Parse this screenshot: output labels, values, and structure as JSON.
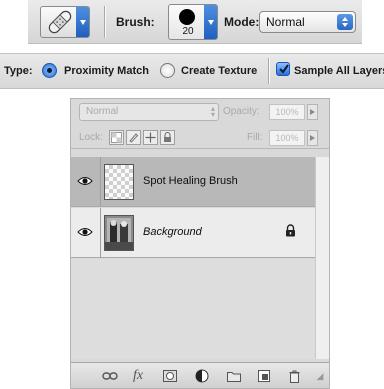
{
  "options_bar": {
    "tool_preset_icon": "bandage-icon",
    "brush_label": "Brush:",
    "brush_size": "20",
    "mode_label": "Mode:",
    "mode_value": "Normal"
  },
  "type_bar": {
    "type_label": "Type:",
    "option_proximity": "Proximity Match",
    "option_texture": "Create Texture",
    "selected": "Proximity Match",
    "sample_all_label": "Sample All Layers",
    "sample_all_checked": true
  },
  "layers_panel": {
    "blend_mode": "Normal",
    "opacity_label": "Opacity:",
    "opacity_value": "100%",
    "lock_label": "Lock:",
    "fill_label": "Fill:",
    "fill_value": "100%",
    "layers": [
      {
        "name": "Spot Healing Brush",
        "selected": true,
        "visible": true
      },
      {
        "name": "Background",
        "selected": false,
        "visible": true,
        "locked": true
      }
    ],
    "bottom_icons": [
      "link-icon",
      "fx-icon",
      "mask-icon",
      "adjustment-icon",
      "group-folder-icon",
      "new-layer-icon",
      "trash-icon"
    ],
    "bottom_fx_text": "fx"
  }
}
